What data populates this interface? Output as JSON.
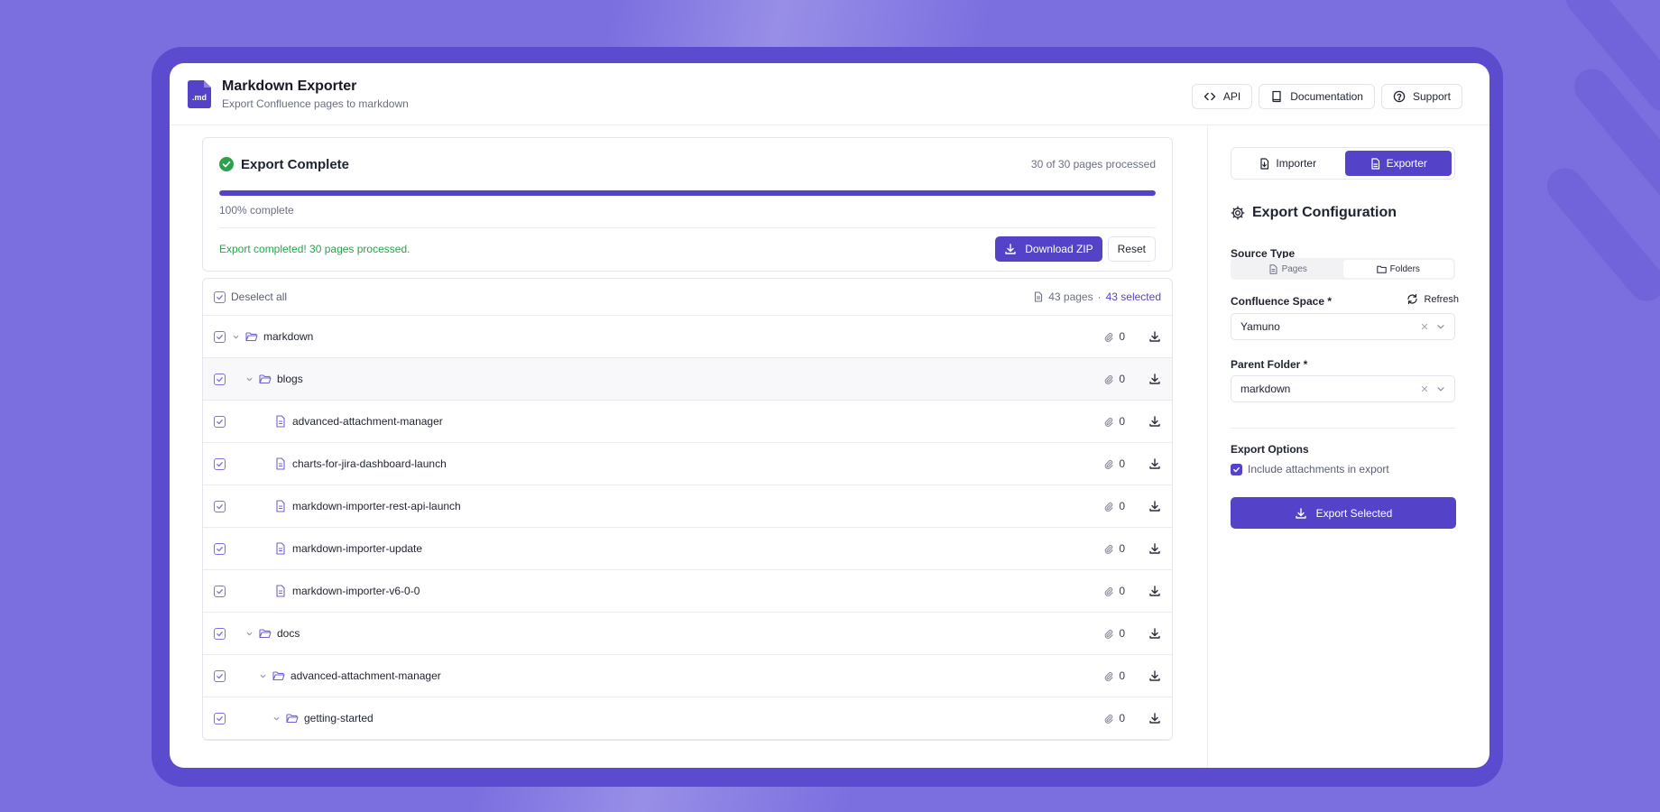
{
  "app": {
    "logo_text": ".md",
    "title": "Markdown Exporter",
    "subtitle": "Export Confluence pages to markdown"
  },
  "header": {
    "buttons": [
      {
        "label": "API",
        "icon": "code-icon"
      },
      {
        "label": "Documentation",
        "icon": "book-icon"
      },
      {
        "label": "Support",
        "icon": "help-circle-icon"
      }
    ]
  },
  "status": {
    "title": "Export Complete",
    "count_text": "30 of 30 pages processed",
    "progress_fraction": 1.0,
    "percent_text": "100% complete",
    "message": "Export completed! 30 pages processed.",
    "download_label": "Download ZIP",
    "reset_label": "Reset",
    "colors": {
      "success": "#2aa14d",
      "accent": "#5443c9"
    }
  },
  "tree": {
    "deselect_label": "Deselect all",
    "pages_text": "43 pages",
    "separator": "·",
    "selected_text": "43 selected",
    "rows": [
      {
        "label": "markdown",
        "type": "folder",
        "depth": 0,
        "expandable": true,
        "count": "0",
        "highlighted": false
      },
      {
        "label": "blogs",
        "type": "folder",
        "depth": 1,
        "expandable": true,
        "count": "0",
        "highlighted": true
      },
      {
        "label": "advanced-attachment-manager",
        "type": "page",
        "depth": 2,
        "expandable": false,
        "count": "0",
        "highlighted": false
      },
      {
        "label": "charts-for-jira-dashboard-launch",
        "type": "page",
        "depth": 2,
        "expandable": false,
        "count": "0",
        "highlighted": false
      },
      {
        "label": "markdown-importer-rest-api-launch",
        "type": "page",
        "depth": 2,
        "expandable": false,
        "count": "0",
        "highlighted": false
      },
      {
        "label": "markdown-importer-update",
        "type": "page",
        "depth": 2,
        "expandable": false,
        "count": "0",
        "highlighted": false
      },
      {
        "label": "markdown-importer-v6-0-0",
        "type": "page",
        "depth": 2,
        "expandable": false,
        "count": "0",
        "highlighted": false
      },
      {
        "label": "docs",
        "type": "folder",
        "depth": 1,
        "expandable": true,
        "count": "0",
        "highlighted": false
      },
      {
        "label": "advanced-attachment-manager",
        "type": "folder",
        "depth": 2,
        "expandable": true,
        "count": "0",
        "highlighted": false
      },
      {
        "label": "getting-started",
        "type": "folder",
        "depth": 3,
        "expandable": true,
        "count": "0",
        "highlighted": false
      }
    ]
  },
  "sidebar": {
    "tabs": [
      {
        "label": "Importer",
        "active": false
      },
      {
        "label": "Exporter",
        "active": true
      }
    ],
    "section_title": "Export Configuration",
    "source_type_label": "Source Type",
    "source_types": [
      {
        "label": "Pages",
        "active": false
      },
      {
        "label": "Folders",
        "active": true
      }
    ],
    "space_label": "Confluence Space *",
    "refresh_label": "Refresh",
    "space_value": "Yamuno",
    "folder_label": "Parent Folder *",
    "folder_value": "markdown",
    "options_label": "Export Options",
    "include_attachments_label": "Include attachments in export",
    "include_attachments_checked": true,
    "export_label": "Export Selected"
  }
}
